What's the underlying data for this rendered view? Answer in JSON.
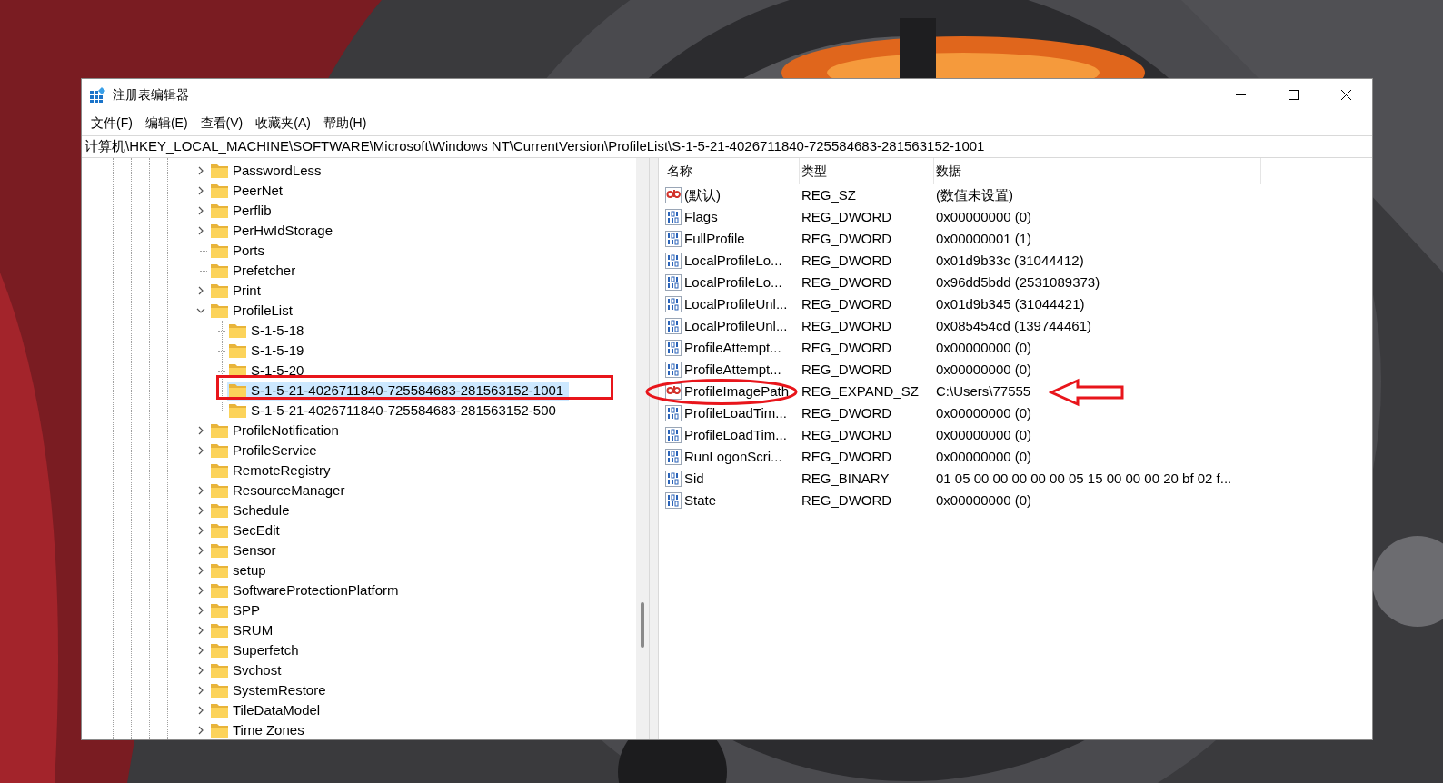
{
  "window": {
    "title": "注册表编辑器"
  },
  "menu": [
    "文件(F)",
    "编辑(E)",
    "查看(V)",
    "收藏夹(A)",
    "帮助(H)"
  ],
  "address": "计算机\\HKEY_LOCAL_MACHINE\\SOFTWARE\\Microsoft\\Windows NT\\CurrentVersion\\ProfileList\\S-1-5-21-4026711840-725584683-281563152-1001",
  "tree": [
    {
      "label": "PasswordLess",
      "kind": "collapsed",
      "selected": false
    },
    {
      "label": "PeerNet",
      "kind": "collapsed",
      "selected": false
    },
    {
      "label": "Perflib",
      "kind": "collapsed",
      "selected": false
    },
    {
      "label": "PerHwIdStorage",
      "kind": "collapsed",
      "selected": false
    },
    {
      "label": "Ports",
      "kind": "leaf",
      "selected": false
    },
    {
      "label": "Prefetcher",
      "kind": "leaf",
      "selected": false
    },
    {
      "label": "Print",
      "kind": "collapsed",
      "selected": false
    },
    {
      "label": "ProfileList",
      "kind": "expanded",
      "selected": false,
      "children": [
        {
          "label": "S-1-5-18",
          "kind": "leaf",
          "selected": false
        },
        {
          "label": "S-1-5-19",
          "kind": "leaf",
          "selected": false
        },
        {
          "label": "S-1-5-20",
          "kind": "leaf",
          "selected": false
        },
        {
          "label": "S-1-5-21-4026711840-725584683-281563152-1001",
          "kind": "leaf",
          "selected": true
        },
        {
          "label": "S-1-5-21-4026711840-725584683-281563152-500",
          "kind": "leaf",
          "selected": false
        }
      ]
    },
    {
      "label": "ProfileNotification",
      "kind": "collapsed",
      "selected": false
    },
    {
      "label": "ProfileService",
      "kind": "collapsed",
      "selected": false
    },
    {
      "label": "RemoteRegistry",
      "kind": "leaf",
      "selected": false
    },
    {
      "label": "ResourceManager",
      "kind": "collapsed",
      "selected": false
    },
    {
      "label": "Schedule",
      "kind": "collapsed",
      "selected": false
    },
    {
      "label": "SecEdit",
      "kind": "collapsed",
      "selected": false
    },
    {
      "label": "Sensor",
      "kind": "collapsed",
      "selected": false
    },
    {
      "label": "setup",
      "kind": "collapsed",
      "selected": false
    },
    {
      "label": "SoftwareProtectionPlatform",
      "kind": "collapsed",
      "selected": false
    },
    {
      "label": "SPP",
      "kind": "collapsed",
      "selected": false
    },
    {
      "label": "SRUM",
      "kind": "collapsed",
      "selected": false
    },
    {
      "label": "Superfetch",
      "kind": "collapsed",
      "selected": false
    },
    {
      "label": "Svchost",
      "kind": "collapsed",
      "selected": false
    },
    {
      "label": "SystemRestore",
      "kind": "collapsed",
      "selected": false
    },
    {
      "label": "TileDataModel",
      "kind": "collapsed",
      "selected": false
    },
    {
      "label": "Time Zones",
      "kind": "collapsed",
      "selected": false
    }
  ],
  "table": {
    "columns": [
      "名称",
      "类型",
      "数据"
    ],
    "rows": [
      {
        "kind": "string",
        "name": "(默认)",
        "type": "REG_SZ",
        "data": "(数值未设置)"
      },
      {
        "kind": "binary",
        "name": "Flags",
        "type": "REG_DWORD",
        "data": "0x00000000 (0)"
      },
      {
        "kind": "binary",
        "name": "FullProfile",
        "type": "REG_DWORD",
        "data": "0x00000001 (1)"
      },
      {
        "kind": "binary",
        "name": "LocalProfileLo...",
        "type": "REG_DWORD",
        "data": "0x01d9b33c (31044412)"
      },
      {
        "kind": "binary",
        "name": "LocalProfileLo...",
        "type": "REG_DWORD",
        "data": "0x96dd5bdd (2531089373)"
      },
      {
        "kind": "binary",
        "name": "LocalProfileUnl...",
        "type": "REG_DWORD",
        "data": "0x01d9b345 (31044421)"
      },
      {
        "kind": "binary",
        "name": "LocalProfileUnl...",
        "type": "REG_DWORD",
        "data": "0x085454cd (139744461)"
      },
      {
        "kind": "binary",
        "name": "ProfileAttempt...",
        "type": "REG_DWORD",
        "data": "0x00000000 (0)"
      },
      {
        "kind": "binary",
        "name": "ProfileAttempt...",
        "type": "REG_DWORD",
        "data": "0x00000000 (0)"
      },
      {
        "kind": "string",
        "name": "ProfileImagePath",
        "type": "REG_EXPAND_SZ",
        "data": "C:\\Users\\77555"
      },
      {
        "kind": "binary",
        "name": "ProfileLoadTim...",
        "type": "REG_DWORD",
        "data": "0x00000000 (0)"
      },
      {
        "kind": "binary",
        "name": "ProfileLoadTim...",
        "type": "REG_DWORD",
        "data": "0x00000000 (0)"
      },
      {
        "kind": "binary",
        "name": "RunLogonScri...",
        "type": "REG_DWORD",
        "data": "0x00000000 (0)"
      },
      {
        "kind": "binary",
        "name": "Sid",
        "type": "REG_BINARY",
        "data": "01 05 00 00 00 00 00 05 15 00 00 00 20 bf 02 f..."
      },
      {
        "kind": "binary",
        "name": "State",
        "type": "REG_DWORD",
        "data": "0x00000000 (0)"
      }
    ]
  }
}
